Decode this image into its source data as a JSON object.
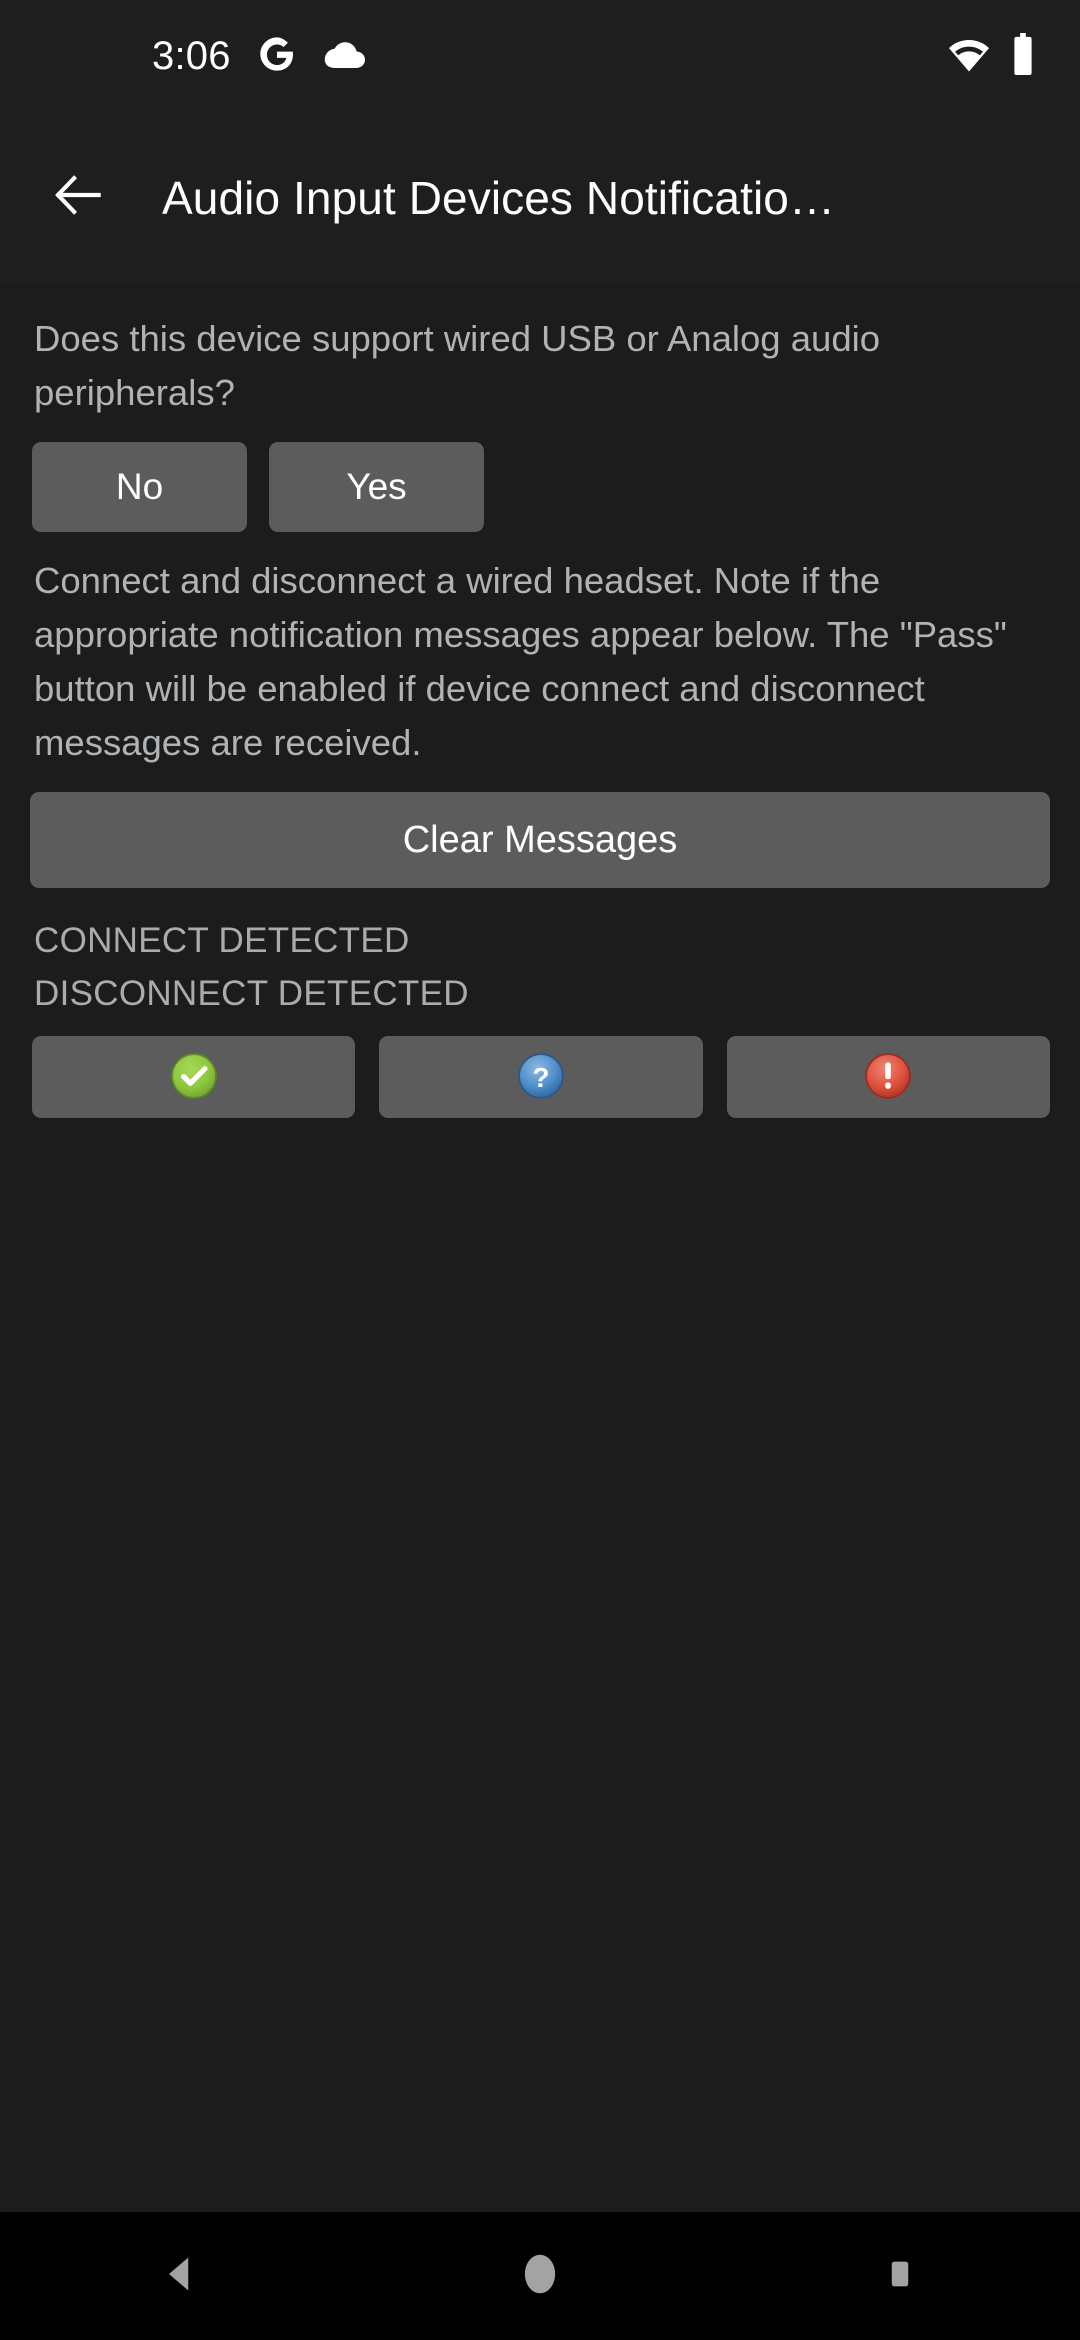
{
  "status_bar": {
    "time": "3:06",
    "icons": [
      "google-g-icon",
      "cloud-icon"
    ],
    "right_icons": [
      "wifi-icon",
      "battery-icon"
    ]
  },
  "app_bar": {
    "back_icon": "back-arrow-icon",
    "title": "Audio Input Devices Notificatio…"
  },
  "content": {
    "question": "Does this device support wired USB or Analog audio peripherals?",
    "answer_buttons": [
      {
        "label": "No"
      },
      {
        "label": "Yes"
      }
    ],
    "instructions": "Connect and disconnect a wired headset. Note if the appropriate notification messages appear below. The \"Pass\" button will be enabled if device connect and disconnect messages are received.",
    "clear_button": "Clear Messages",
    "status_lines": [
      "CONNECT DETECTED",
      "DISCONNECT DETECTED"
    ],
    "verdict_buttons": [
      {
        "name": "pass-button",
        "icon": "check-circle-icon",
        "color": "#8bc34a"
      },
      {
        "name": "info-button",
        "icon": "question-circle-icon",
        "color": "#4a90d9"
      },
      {
        "name": "fail-button",
        "icon": "exclamation-circle-icon",
        "color": "#e04b3a"
      }
    ]
  },
  "nav_bar": {
    "buttons": [
      "back-nav-icon",
      "home-nav-icon",
      "recents-nav-icon"
    ]
  },
  "colors": {
    "background": "#1c1c1c",
    "app_bar": "#1e1e1e",
    "button": "#5c5c5c",
    "text_primary": "#ffffff",
    "text_secondary": "#b0b3b5",
    "nav_bar": "#000000"
  }
}
